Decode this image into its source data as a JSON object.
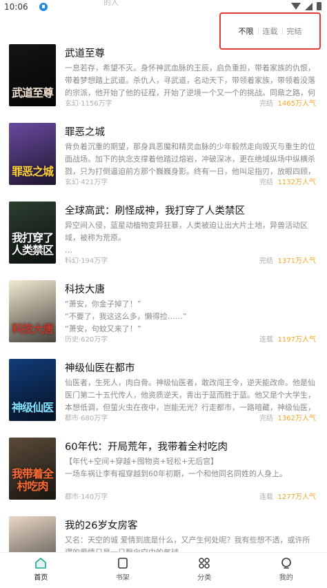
{
  "status_bar": {
    "time": "10:06",
    "title_fragment": "的人"
  },
  "filter": {
    "options": [
      "不限",
      "连载",
      "完结"
    ],
    "selected": "不限"
  },
  "books": [
    {
      "title": "武道至尊",
      "desc": "一息若存，希望不灭。身怀神武血脉的王辰，启负重担，带着家族的仇恨，带着梦想踏上武道。杀仇人，寻武道，名动天下，带领着家族，带领着没落的宗派，他开始了他的征程，开始了逆境一个又一个的挑战。同鼎之路，何其困难…",
      "meta": "玄幻·1156万字",
      "status": "完结",
      "popularity": "1465万人气",
      "cover_text": "武道至尊",
      "cover_bg": "#141414",
      "cover_text_color": "#f0e0d0"
    },
    {
      "title": "罪恶之城",
      "desc": "背负着沉重的期望，那身具恶魔和精灵血脉的少年毅然走向毁灭与重生的位面战场。加下的执念支撑着他踏过熔岩，冲破深冰，更在绝域纵场中纵横杀戮，只为打倒逼迫前方那个巍巍身影。终有一日，他叫足指刃，放眼四顾，却发…",
      "meta": "玄幻·421万字",
      "status": "完结",
      "popularity": "1132万人气",
      "cover_text": "罪恶之城",
      "cover_bg": "#6a4aa0",
      "cover_text_color": "#ffd43b"
    },
    {
      "title": "全球高武：刷怪成神，我打穿了人类禁区",
      "desc": "异空间入侵，蓝星动植物变异狂暴，人类被迫让出大片土地，异兽活动区域，被称为荒原。\n…",
      "meta": "科幻·194万字",
      "status": "完结",
      "popularity": "1371万人气",
      "cover_text": "我打穿了人类禁区",
      "cover_bg": "#2c3e30",
      "cover_text_color": "#ffffff"
    },
    {
      "title": "科技大唐",
      "desc": "“萧安，你金子掉了！”\n“不要了，我这这么多，懒得捡……”\n“萧安，句蚊又来了！”",
      "meta": "历史·620万字",
      "status": "连载",
      "popularity": "1197万人气",
      "cover_text": "科技大唐",
      "cover_bg": "#f3e9d2",
      "cover_text_color": "#c0392b"
    },
    {
      "title": "神级仙医在都市",
      "desc": "仙医者，生死人，肉白骨。神级仙医者，敢改闯王令，逆天能改命。他是仙医门第二十五代传人，他资质逆天，青出于蓝而胜于蓝。他又是个大学生，本想低调，但萤火虫在夜中，岂能无光？行走都市，一路暗藏，神级仙医，我心逍遥…",
      "meta": "都市·680万字",
      "status": "完结",
      "popularity": "1362万人气",
      "cover_text": "神级仙医",
      "cover_bg": "#123c7a",
      "cover_text_color": "#7fe3ff"
    },
    {
      "title": "60年代：开局荒年，我带着全村吃肉",
      "desc": "【年代+空间+穿越+囤物资+轻松+无后宫】\n一场车祸让李有福穿越到60年初期，一个和他同名同姓的人身上。",
      "meta": "都市·140万字",
      "status": "连载",
      "popularity": "1277万人气",
      "cover_text": "我带着全村吃肉",
      "cover_bg": "#5a4a3a",
      "cover_text_color": "#ff6b35"
    },
    {
      "title": "我的26岁女房客",
      "desc": "又名：天空的城 爱情到底是什么，又产生何处呢？我有些想不透，或许所谓的爱情只是一只飘向空中的气球…",
      "meta": "",
      "status": "",
      "popularity": "",
      "cover_text": "",
      "cover_bg": "#e9d8c8",
      "cover_text_color": "#ffffff"
    }
  ],
  "tabs": [
    {
      "label": "首页",
      "active": true
    },
    {
      "label": "书架",
      "active": false
    },
    {
      "label": "分类",
      "active": false
    },
    {
      "label": "我的",
      "active": false
    }
  ]
}
